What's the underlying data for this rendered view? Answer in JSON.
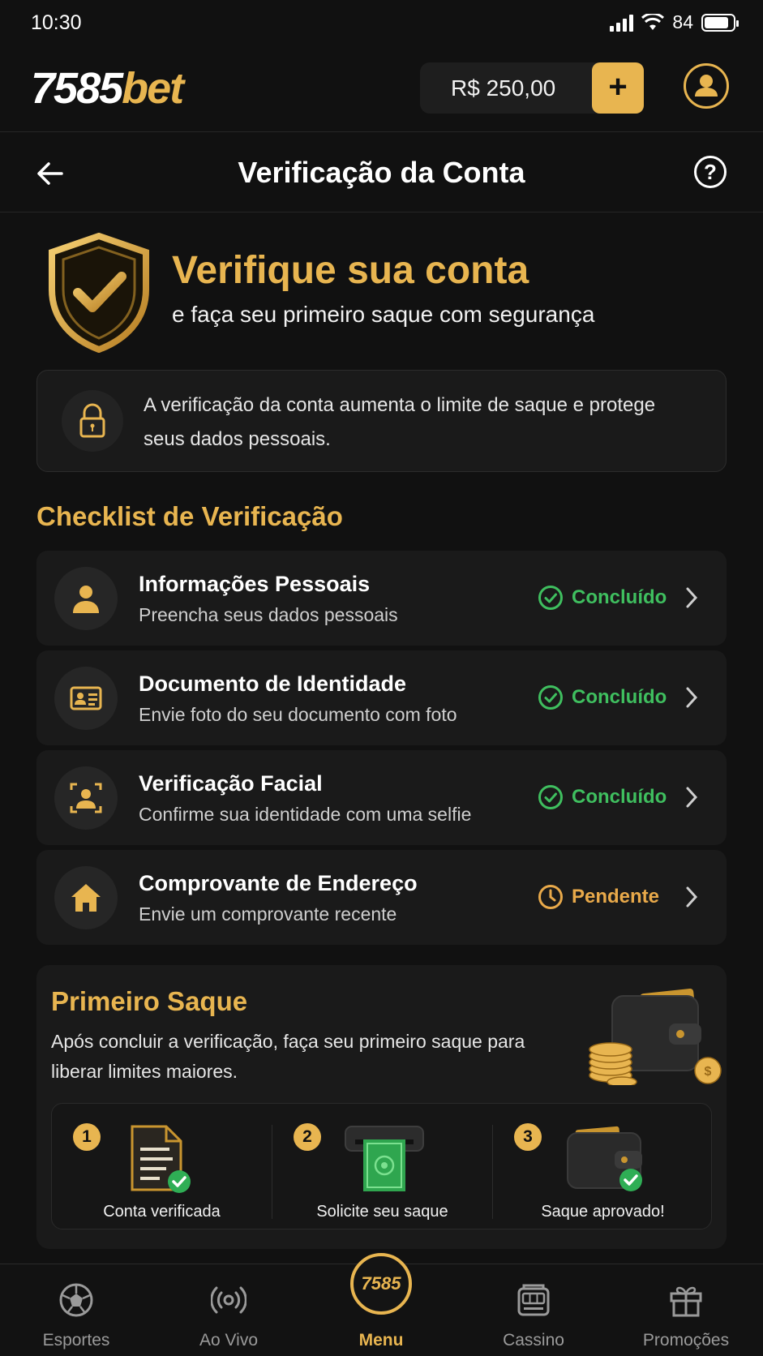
{
  "status_bar": {
    "time": "10:30",
    "battery": "84"
  },
  "header": {
    "logo_num": "7585",
    "logo_suffix": "bet",
    "balance": "R$ 250,00",
    "add_label": "+"
  },
  "page": {
    "title": "Verificação da Conta",
    "help_label": "?"
  },
  "hero": {
    "title": "Verifique sua conta",
    "subtitle": "e faça seu primeiro saque com segurança"
  },
  "info": {
    "text": "A verificação da conta aumenta o limite de saque e protege seus dados pessoais."
  },
  "checklist": {
    "title": "Checklist de Verificação",
    "items": [
      {
        "icon": "person-icon",
        "title": "Informações Pessoais",
        "subtitle": "Preencha seus dados pessoais",
        "status": "Concluído",
        "state": "done"
      },
      {
        "icon": "id-card-icon",
        "title": "Documento de Identidade",
        "subtitle": "Envie foto do seu documento com foto",
        "status": "Concluído",
        "state": "done"
      },
      {
        "icon": "face-scan-icon",
        "title": "Verificação Facial",
        "subtitle": "Confirme sua identidade com uma selfie",
        "status": "Concluído",
        "state": "done"
      },
      {
        "icon": "home-icon",
        "title": "Comprovante de Endereço",
        "subtitle": "Envie um comprovante recente",
        "status": "Pendente",
        "state": "pending"
      }
    ]
  },
  "first_withdraw": {
    "title": "Primeiro Saque",
    "description": "Após concluir a verificação, faça seu primeiro saque para liberar limites maiores.",
    "steps": [
      {
        "number": "1",
        "label": "Conta verificada",
        "icon": "document-check-icon"
      },
      {
        "number": "2",
        "label": "Solicite seu saque",
        "icon": "cash-atm-icon"
      },
      {
        "number": "3",
        "label": "Saque aprovado!",
        "icon": "wallet-check-icon"
      }
    ]
  },
  "bottom_nav": {
    "items": [
      {
        "label": "Esportes",
        "icon": "soccer-ball-icon"
      },
      {
        "label": "Ao Vivo",
        "icon": "live-broadcast-icon"
      },
      {
        "label": "Menu",
        "icon": "menu-logo-icon",
        "badge": "7585",
        "active": true
      },
      {
        "label": "Cassino",
        "icon": "slot-machine-icon"
      },
      {
        "label": "Promoções",
        "icon": "gift-icon"
      }
    ]
  },
  "colors": {
    "accent": "#e8b550",
    "background": "#111111",
    "card": "#1a1a1a",
    "success": "#3fbf5f",
    "pending": "#e8a94a"
  }
}
